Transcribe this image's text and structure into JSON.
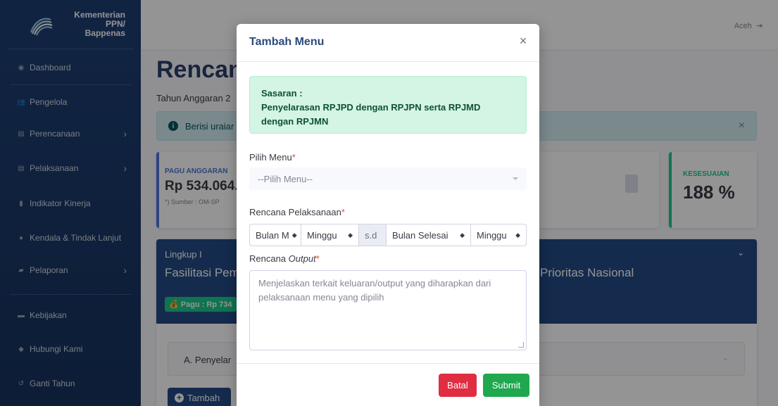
{
  "sidebar": {
    "brand_line1": "Kementerian PPN/",
    "brand_line2": "Bappenas",
    "items": [
      {
        "label": "Dashboard",
        "icon": "dashboard-icon"
      },
      {
        "label": "Pengelola",
        "icon": "users-icon"
      },
      {
        "label": "Perencanaan",
        "icon": "clipboard-icon",
        "has_submenu": true
      },
      {
        "label": "Pelaksanaan",
        "icon": "clipboard-icon",
        "has_submenu": true
      },
      {
        "label": "Indikator Kinerja",
        "icon": "bar-chart-icon"
      },
      {
        "label": "Kendala & Tindak Lanjut",
        "icon": "info-circle-icon"
      },
      {
        "label": "Pelaporan",
        "icon": "file-export-icon",
        "has_submenu": true
      },
      {
        "label": "Kebijakan",
        "icon": "folder-icon"
      },
      {
        "label": "Hubungi Kami",
        "icon": "chat-icon"
      },
      {
        "label": "Ganti Tahun",
        "icon": "history-icon"
      }
    ]
  },
  "topbar": {
    "user": "Aceh"
  },
  "main": {
    "title": "Rencan",
    "subtitle": "Tahun Anggaran 2",
    "alert_text": "Berisi uraiar",
    "pagu_label": "PAGU ANGGARAN",
    "pagu_value": "Rp 534.064.",
    "pagu_source": "*) Sumber : OM-SP",
    "kesesuaian_label": "KESESUAIAN",
    "kesesuaian_value": "188 %",
    "lingkup_label": "Lingkup I",
    "lingkup_title_left": "Fasilitasi Pem",
    "lingkup_title_right": "Prioritas Nasional",
    "lingkup_badge": "Pagu : Rp 734",
    "sub_item": "A. Penyelar",
    "tambah_label": "Tambah"
  },
  "modal": {
    "title": "Tambah Menu",
    "close": "×",
    "sasaran_label": "Sasaran :",
    "sasaran_text": "Penyelarasan RPJPD dengan RPJPN serta RPJMD dengan RPJMN",
    "pilih_menu_label": "Pilih Menu",
    "pilih_menu_placeholder": "--Pilih Menu--",
    "rencana_label": "Rencana Pelaksanaan",
    "range": {
      "bulan_mulai": "Bulan M",
      "minggu_mulai": "Minggu",
      "sd": "s.d",
      "bulan_selesai": "Bulan Selesai",
      "minggu_selesai": "Minggu"
    },
    "output_label_prefix": "Rencana ",
    "output_label_em": "Output",
    "output_placeholder": "Menjelaskan terkait keluaran/output yang diharapkan dari pelaksanaan menu yang dipilih",
    "required_mark": "*",
    "batal": "Batal",
    "submit": "Submit"
  },
  "colors": {
    "sidebar": "#1d3f73",
    "primary": "#234a86",
    "success": "#1cc88a",
    "danger": "#e02d42",
    "submit": "#1fa84f",
    "sasaran_bg": "#d4f4e4"
  }
}
